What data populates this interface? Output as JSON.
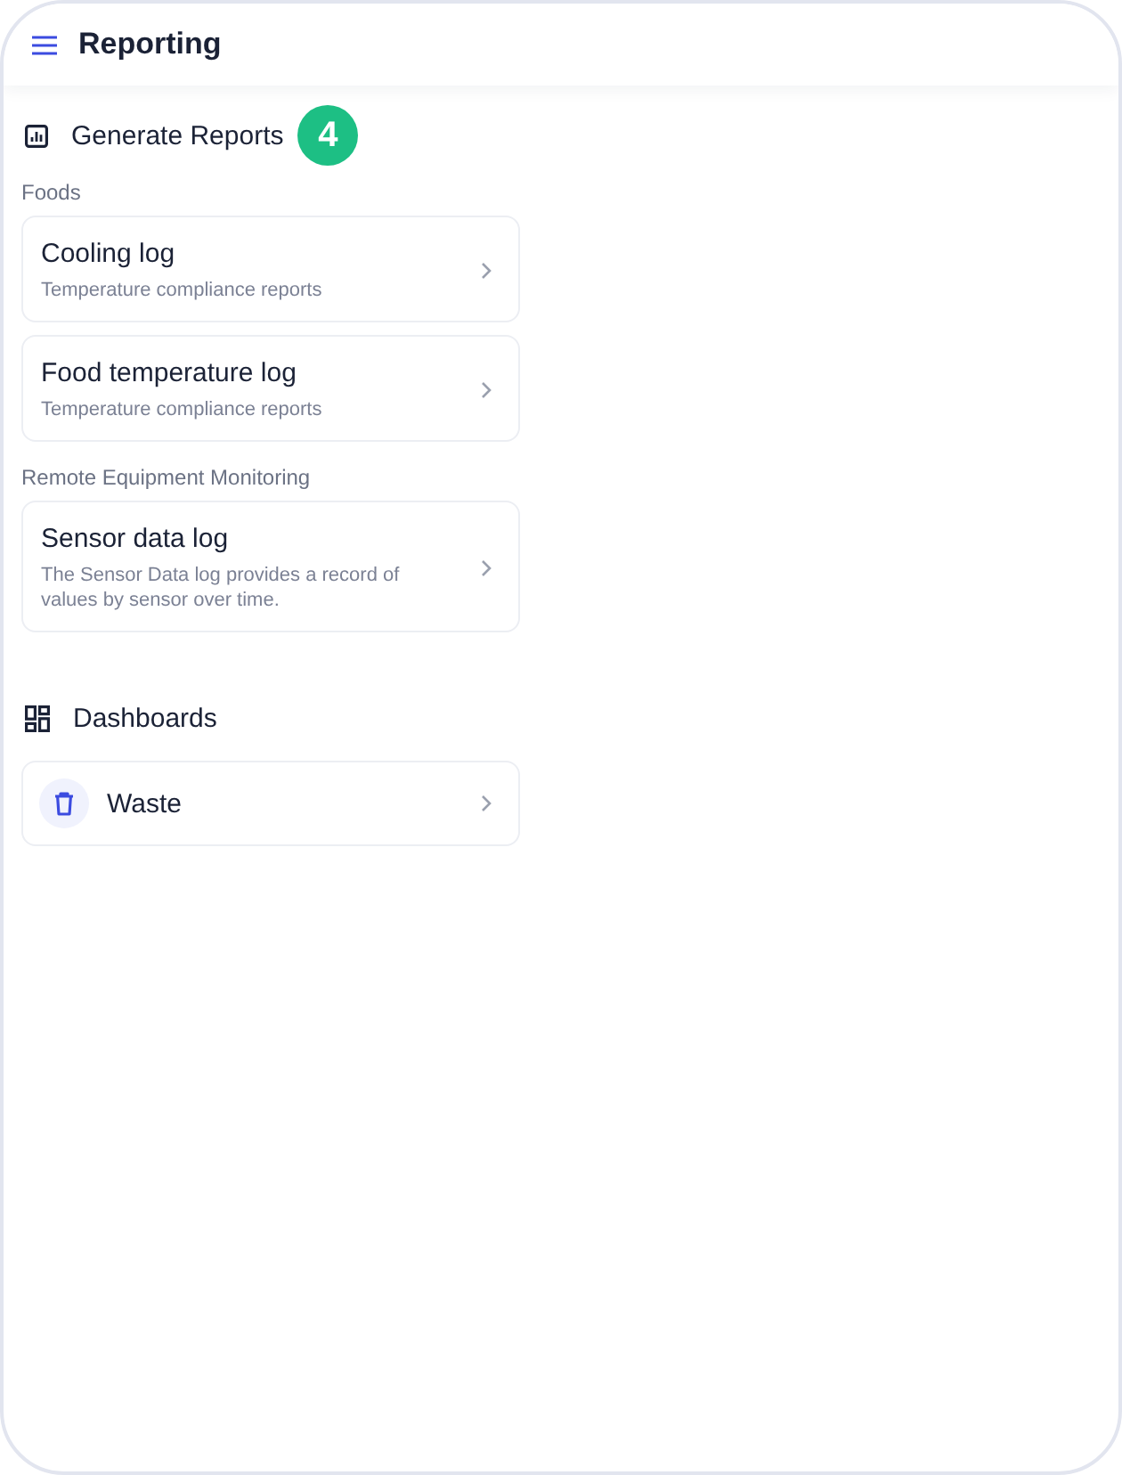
{
  "app_bar": {
    "title": "Reporting"
  },
  "sections": [
    {
      "kind": "reports",
      "title": "Generate Reports",
      "badge": "4",
      "groups": [
        {
          "label": "Foods",
          "items": [
            {
              "title": "Cooling log",
              "subtitle": "Temperature compliance reports"
            },
            {
              "title": "Food temperature log",
              "subtitle": "Temperature compliance reports"
            }
          ]
        },
        {
          "label": "Remote Equipment Monitoring",
          "items": [
            {
              "title": "Sensor data log",
              "subtitle": "The Sensor Data log provides a record of values by sensor over time."
            }
          ]
        }
      ]
    },
    {
      "kind": "dashboards",
      "title": "Dashboards",
      "items": [
        {
          "title": "Waste"
        }
      ]
    }
  ]
}
